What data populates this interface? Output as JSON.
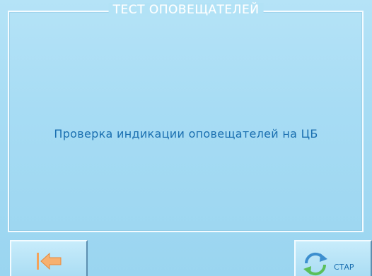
{
  "screen": {
    "title": "ТЕСТ ОПОВЕЩАТЕЛЕЙ",
    "message": "Проверка индикации оповещателей на ЦБ"
  },
  "buttons": {
    "back": {
      "icon": "back-arrow-icon"
    },
    "start": {
      "label": "СТАР",
      "icon": "refresh-icon"
    }
  },
  "colors": {
    "background": "#a7dcf4",
    "title_text": "#ffffff",
    "message_text": "#1a6fb0",
    "back_arrow": "#f0a050"
  }
}
